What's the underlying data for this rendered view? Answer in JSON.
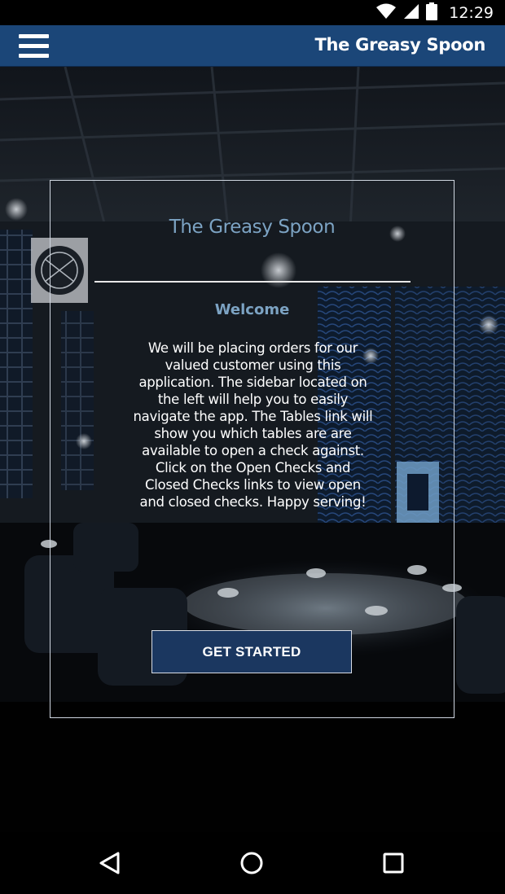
{
  "status_bar": {
    "time": "12:29",
    "icons": [
      "wifi-icon",
      "signal-icon",
      "battery-icon"
    ]
  },
  "app_bar": {
    "title": "The Greasy Spoon",
    "menu_icon": "hamburger-menu-icon",
    "color": "#1b4678"
  },
  "card": {
    "title": "The Greasy Spoon",
    "subtitle": "Welcome",
    "body": "We will be placing orders for our valued customer using this application. The sidebar located on the left will help you to easily navigate the app. The Tables link will show you which tables are are available to open a check against. Click on the Open Checks and Closed Checks links to view open and closed checks. Happy serving!",
    "cta_label": "GET STARTED",
    "accent_color": "#7ca3c3",
    "button_color": "#1b3760"
  },
  "nav_bar": {
    "icons": [
      "back-icon",
      "home-icon",
      "recents-icon"
    ]
  }
}
